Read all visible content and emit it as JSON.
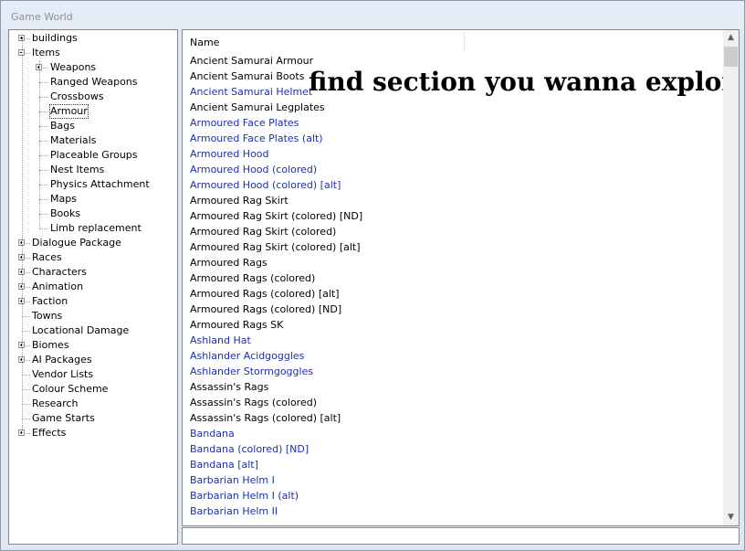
{
  "window": {
    "title": "Game World"
  },
  "tree": {
    "items": [
      {
        "label": "buildings",
        "expander": "plus"
      },
      {
        "label": "Items",
        "expander": "minus"
      },
      {
        "label": "Weapons",
        "expander": "plus"
      },
      {
        "label": "Ranged Weapons"
      },
      {
        "label": "Crossbows"
      },
      {
        "label": "Armour",
        "selected": true
      },
      {
        "label": "Bags"
      },
      {
        "label": "Materials"
      },
      {
        "label": "Placeable Groups"
      },
      {
        "label": "Nest Items"
      },
      {
        "label": "Physics Attachment"
      },
      {
        "label": "Maps"
      },
      {
        "label": "Books"
      },
      {
        "label": "Limb replacement"
      },
      {
        "label": "Dialogue Package",
        "expander": "plus"
      },
      {
        "label": "Races",
        "expander": "plus"
      },
      {
        "label": "Characters",
        "expander": "plus"
      },
      {
        "label": "Animation",
        "expander": "plus"
      },
      {
        "label": "Faction",
        "expander": "plus"
      },
      {
        "label": "Towns"
      },
      {
        "label": "Locational Damage"
      },
      {
        "label": "Biomes",
        "expander": "plus"
      },
      {
        "label": "AI Packages",
        "expander": "plus"
      },
      {
        "label": "Vendor Lists"
      },
      {
        "label": "Colour Scheme"
      },
      {
        "label": "Research"
      },
      {
        "label": "Game Starts"
      },
      {
        "label": "Effects",
        "expander": "plus"
      }
    ]
  },
  "list": {
    "column_header": "Name",
    "overlay_caption": "find section you wanna explore",
    "colors": {
      "normal": "#000000",
      "highlighted": "#1c2fb0"
    },
    "items": [
      {
        "label": "Ancient Samurai Armour",
        "blue": false
      },
      {
        "label": "Ancient Samurai Boots",
        "blue": false
      },
      {
        "label": "Ancient Samurai Helmet",
        "blue": true
      },
      {
        "label": "Ancient Samurai Legplates",
        "blue": false
      },
      {
        "label": "Armoured Face Plates",
        "blue": true
      },
      {
        "label": "Armoured Face Plates (alt)",
        "blue": true
      },
      {
        "label": "Armoured Hood",
        "blue": true
      },
      {
        "label": "Armoured Hood (colored)",
        "blue": true
      },
      {
        "label": "Armoured Hood (colored) [alt]",
        "blue": true
      },
      {
        "label": "Armoured Rag Skirt",
        "blue": false
      },
      {
        "label": "Armoured Rag Skirt  (colored) [ND]",
        "blue": false
      },
      {
        "label": "Armoured Rag Skirt (colored)",
        "blue": false
      },
      {
        "label": "Armoured Rag Skirt (colored) [alt]",
        "blue": false
      },
      {
        "label": "Armoured Rags",
        "blue": false
      },
      {
        "label": "Armoured Rags (colored)",
        "blue": false
      },
      {
        "label": "Armoured Rags (colored) [alt]",
        "blue": false
      },
      {
        "label": "Armoured Rags (colored) [ND]",
        "blue": false
      },
      {
        "label": "Armoured Rags SK",
        "blue": false
      },
      {
        "label": "Ashland Hat",
        "blue": true
      },
      {
        "label": "Ashlander Acidgoggles",
        "blue": true
      },
      {
        "label": "Ashlander Stormgoggles",
        "blue": true
      },
      {
        "label": "Assassin's Rags",
        "blue": false
      },
      {
        "label": "Assassin's Rags (colored)",
        "blue": false
      },
      {
        "label": "Assassin's Rags (colored) [alt]",
        "blue": false
      },
      {
        "label": "Bandana",
        "blue": true
      },
      {
        "label": "Bandana (colored) [ND]",
        "blue": true
      },
      {
        "label": "Bandana [alt]",
        "blue": true
      },
      {
        "label": "Barbarian Helm I",
        "blue": true
      },
      {
        "label": "Barbarian Helm I (alt)",
        "blue": true
      },
      {
        "label": "Barbarian Helm II",
        "blue": true
      }
    ]
  },
  "scrollbar": {
    "up_glyph": "▲",
    "down_glyph": "▼"
  }
}
